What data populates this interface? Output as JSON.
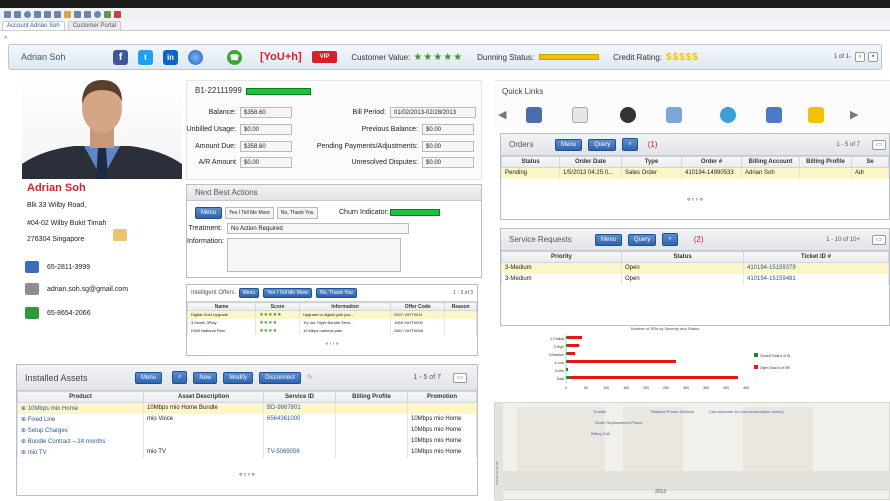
{
  "window": {
    "tab_account": "Account Adrian Soh",
    "tab_portal": "Customer Portal"
  },
  "header": {
    "name": "Adrian Soh",
    "brand": "[YoU+h]",
    "vip": "VIP",
    "customer_value_label": "Customer Value:",
    "customer_value_stars": "★★★★★",
    "dunning_label": "Dunning Status:",
    "credit_label": "Credit Rating:",
    "credit_rating": "$$$$$",
    "pager": "1 of 1-"
  },
  "profile": {
    "name": "Adrian Soh",
    "addr1": "Blk 33 Wilby Road,",
    "addr2": "#04-02 Wilby Bukit Timah",
    "addr3": "276304 Singapore",
    "phone": "65-2811-3999",
    "email": "adrian.soh.sg@gmail.com",
    "mobile": "65-8654-2066"
  },
  "account": {
    "id": "B1-22111999",
    "balance_label": "Balance:",
    "balance": "$358.60",
    "unbilled_label": "Unbilled Usage:",
    "unbilled": "$0.00",
    "amount_due_label": "Amount Due:",
    "amount_due": "$358.60",
    "ar_label": "A/R Amount",
    "ar": "$0.00",
    "bill_period_label": "Bill Period:",
    "bill_period": "01/02/2013-02/28/2013",
    "prev_balance_label": "Previous Balance:",
    "prev_balance": "$0.00",
    "pending_label": "Pending Payments/Adjustments:",
    "pending": "$0.00",
    "disputes_label": "Unresolved Disputes:",
    "disputes": "$0.00"
  },
  "nba": {
    "title": "Next Best Actions",
    "menu": "Menu",
    "btn_yes": "Yes I Tell Me More",
    "btn_no": "No, Thank You",
    "churn_label": "Churn Indicator:",
    "treatment_label": "Treatment:",
    "treatment": "No Action Required",
    "information_label": "Information:"
  },
  "offers": {
    "title": "Intelligent Offers",
    "menu": "Menu",
    "btn_yes": "Yes I Tell Me More",
    "btn_no": "No, Thank You",
    "pager": "1 - 3 of 3",
    "columns": [
      "Name",
      "Score",
      "Information",
      "Offer Code",
      "Reason"
    ],
    "rows": [
      [
        "Digital Gold Upgrade",
        "★★★★★",
        "Upgrade to digital gold pac...",
        "2007-YATT0011",
        ""
      ],
      [
        "3 Month 3Play",
        "★★★★",
        "Try our Triple Bundle Servi...",
        "1069-YATT0000",
        ""
      ],
      [
        "DSM National Plan",
        "★★★★",
        "10 Mbps national plan",
        "1567-YATT0048",
        ""
      ]
    ],
    "nav": "« ‹ › »"
  },
  "assets": {
    "title": "Installed Assets",
    "menu": "Menu",
    "btn_new": "New",
    "btn_modify": "Modify",
    "btn_disconnect": "Disconnect",
    "pager": "1 - 5 of 7",
    "columns": [
      "Product",
      "Asset Description",
      "Service ID",
      "Billing Profile",
      "Promotion"
    ],
    "rows": [
      [
        "10Mbps mio Home",
        "10Mbps mio Home Bundle",
        "BD-9987801",
        "",
        ""
      ],
      [
        "Fixed Line",
        "mio Voice",
        "6564361000",
        "",
        "10Mbps mio Home"
      ],
      [
        "Setup Charges",
        "",
        "",
        "",
        "10Mbps mio Home"
      ],
      [
        "Bundle Contract – 24 months",
        "",
        "",
        "",
        "10Mbps mio Home"
      ],
      [
        "mio TV",
        "mio TV",
        "TV-5069056",
        "",
        "10Mbps mio Home"
      ]
    ],
    "nav": "« ‹ › »"
  },
  "quicklinks": {
    "title": "Quick Links"
  },
  "orders": {
    "title": "Orders",
    "menu": "Menu",
    "query": "Query",
    "annotation": "(1)",
    "pager": "1 - 5 of 7",
    "columns": [
      "Status",
      "Order Date",
      "Type",
      "Order #",
      "Billing Account",
      "Billing Profile",
      "Se"
    ],
    "rows": [
      [
        "Pending",
        "1/5/2013 04:25:0...",
        "Sales Order",
        "410194-14990533",
        "Adrian Soh",
        "",
        "Adr"
      ]
    ],
    "nav": "« ‹ › »"
  },
  "service": {
    "title": "Service Requests",
    "menu": "Menu",
    "query": "Query",
    "annotation": "(2)",
    "pager": "1 - 10 of 10+",
    "columns": [
      "Priority",
      "Status",
      "Ticket ID #"
    ],
    "rows": [
      [
        "3-Medium",
        "Open",
        "410194-15159379"
      ],
      [
        "3-Medium",
        "Open",
        "410194-15159481"
      ]
    ]
  },
  "sr_chart": {
    "title": "Number of SRs by Severity and Status",
    "categories": [
      "1-Critical",
      "2-High",
      "3-Medium",
      "4-Low",
      "5-Info",
      "Total"
    ],
    "legend_closed": "Closed Total # of SRs",
    "legend_open": "Open Total # of SRs",
    "x_ticks": [
      "0",
      "50",
      "100",
      "150",
      "200",
      "250",
      "300",
      "350",
      "400",
      "450"
    ],
    "closed": [
      3,
      3,
      3,
      4,
      0,
      10
    ],
    "open": [
      35,
      28,
      18,
      270,
      0,
      420
    ],
    "green": "#1a8a1a",
    "red": "#e01818"
  },
  "timeline": {
    "events": [
      "Trouble",
      "Replace Phone Delivery",
      "Call customer for post-subscription survey",
      "Order Replacement Phone",
      "Billing Call"
    ],
    "year": "2013",
    "axis_label": "Timeline by Month"
  }
}
